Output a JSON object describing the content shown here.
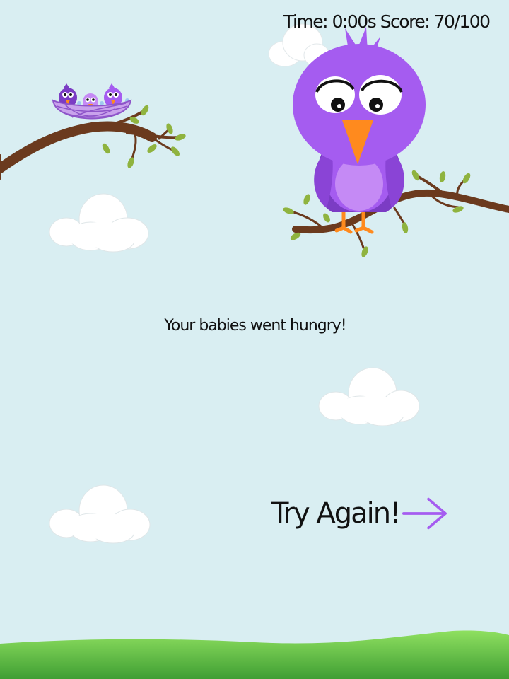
{
  "hud": {
    "time_label": "Time:",
    "time_value": "0:00s",
    "score_label": "Score:",
    "score_value": "70/100"
  },
  "message": "Your babies went hungry!",
  "try_again": {
    "label": "Try Again!",
    "arrow_icon": "right-arrow-icon"
  },
  "colors": {
    "sky": "#d9eef2",
    "bird_purple": "#a55cf0",
    "bird_belly": "#c58af5",
    "beak": "#ff8a1e",
    "branch": "#6b3a1e",
    "leaf": "#8fb33f",
    "grass_light": "#8fe060",
    "grass_dark": "#3f9e33",
    "arrow": "#a55cf0"
  }
}
